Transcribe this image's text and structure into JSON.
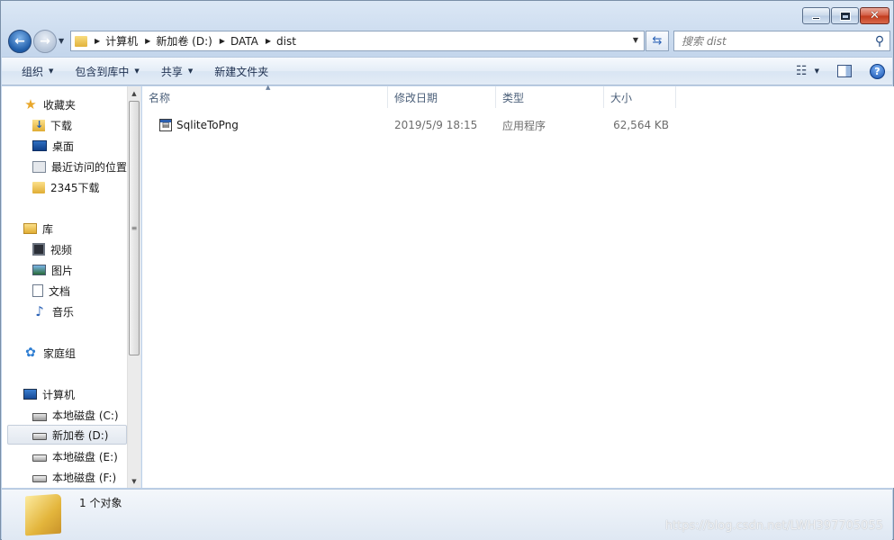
{
  "window": {
    "caption": {
      "minimize": "–",
      "maximize": "□",
      "close": "✕"
    }
  },
  "nav": {
    "back_icon": "←",
    "forward_icon": "→",
    "breadcrumbs": [
      "计算机",
      "新加卷 (D:)",
      "DATA",
      "dist"
    ],
    "search_placeholder": "搜索 dist"
  },
  "toolbar": {
    "organize": "组织",
    "include_in_library": "包含到库中",
    "share": "共享",
    "new_folder": "新建文件夹"
  },
  "sidebar": {
    "favorites": {
      "label": "收藏夹",
      "items": [
        "下载",
        "桌面",
        "最近访问的位置",
        "2345下载"
      ]
    },
    "libraries": {
      "label": "库",
      "items": [
        "视频",
        "图片",
        "文档",
        "音乐"
      ]
    },
    "homegroup": {
      "label": "家庭组"
    },
    "computer": {
      "label": "计算机",
      "items": [
        "本地磁盘 (C:)",
        "新加卷 (D:)",
        "本地磁盘 (E:)",
        "本地磁盘 (F:)"
      ]
    }
  },
  "columns": {
    "name": "名称",
    "modified": "修改日期",
    "type": "类型",
    "size": "大小"
  },
  "files": [
    {
      "name": "SqliteToPng",
      "modified": "2019/5/9 18:15",
      "type": "应用程序",
      "size": "62,564 KB"
    }
  ],
  "status": {
    "count_text": "1 个对象",
    "watermark": "https://blog.csdn.net/LWH397705055"
  }
}
